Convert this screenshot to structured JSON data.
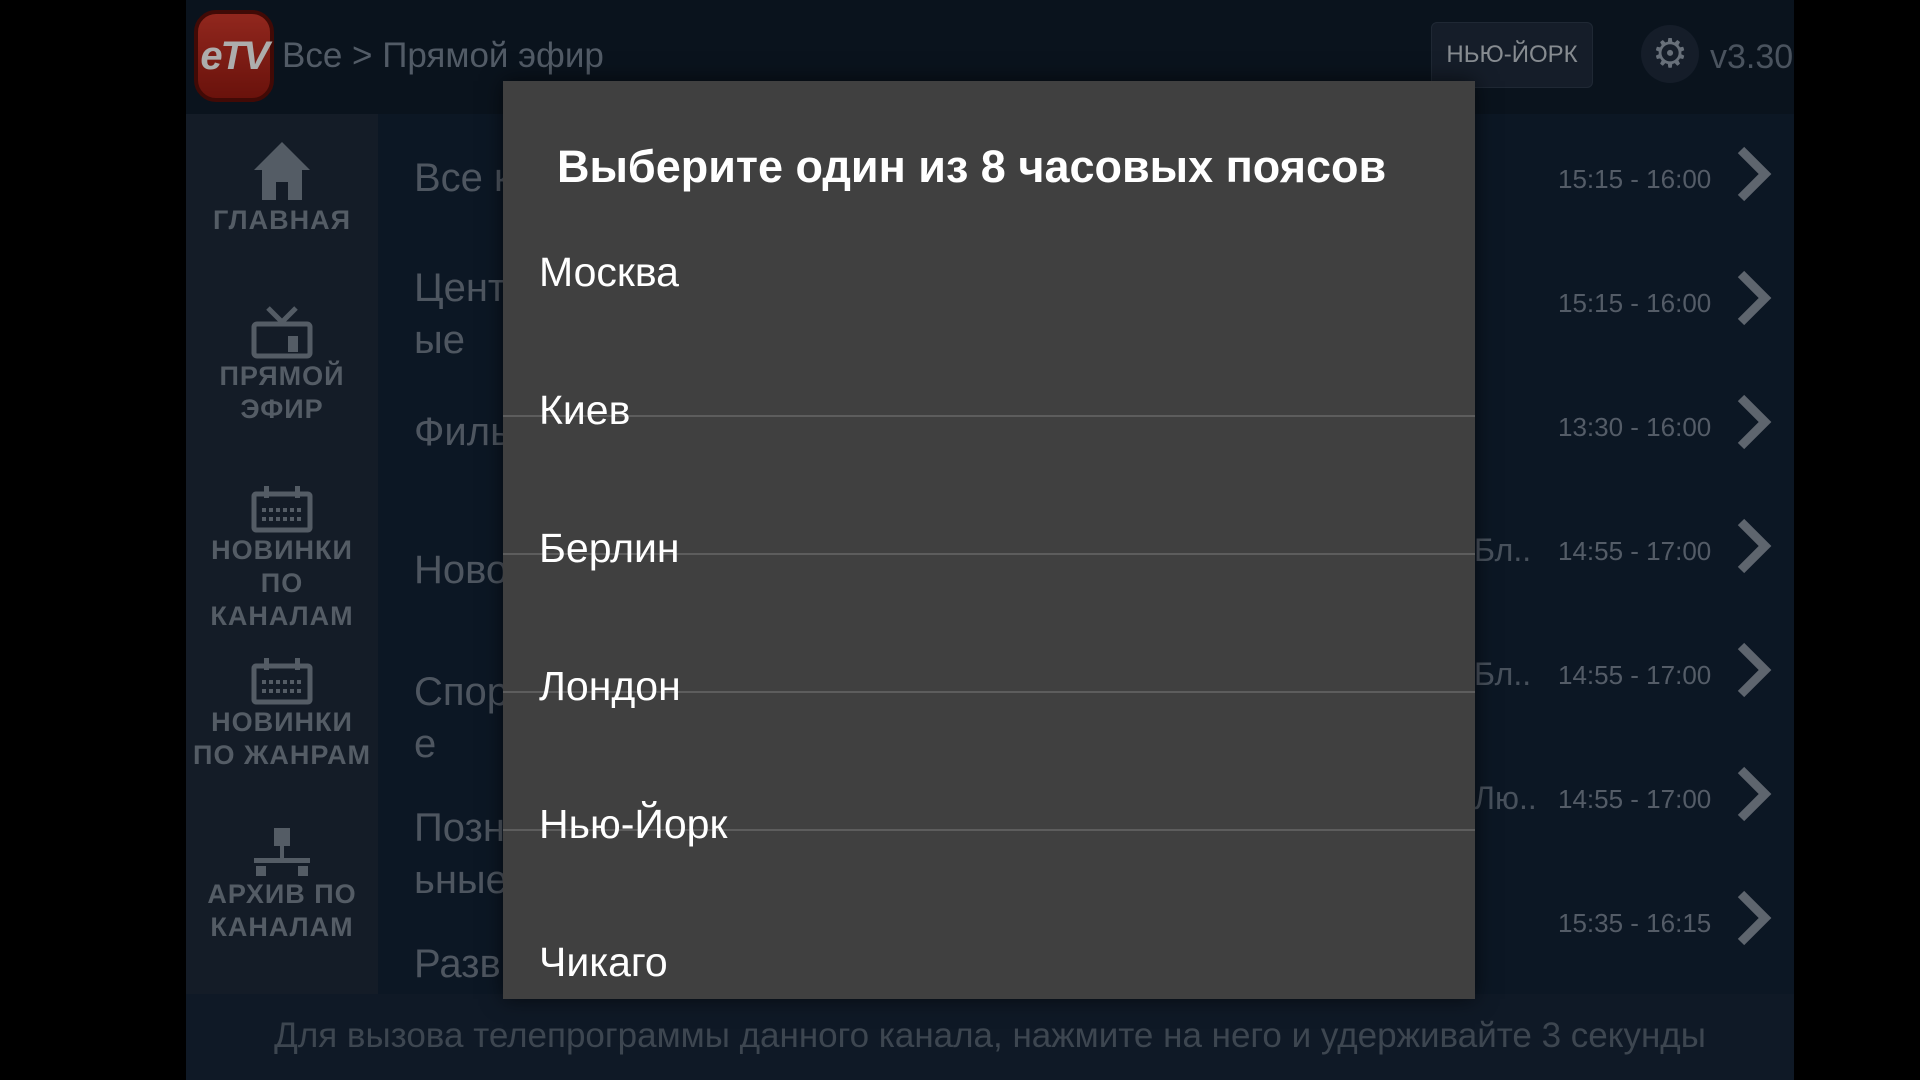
{
  "header": {
    "logo_text": "eTV",
    "breadcrumb": "Все > Прямой эфир",
    "city_button": "НЬЮ-ЙОРК",
    "version": "v3.30"
  },
  "sidebar": {
    "items": [
      {
        "label": "ГЛАВНАЯ",
        "icon": "home-icon"
      },
      {
        "label": "ПРЯМОЙ\nЭФИР",
        "icon": "tv-icon"
      },
      {
        "label": "НОВИНКИ\nПО КАНАЛАМ",
        "icon": "calendar-icon"
      },
      {
        "label": "НОВИНКИ\nПО ЖАНРАМ",
        "icon": "calendar-icon"
      },
      {
        "label": "АРХИВ ПО\nКАНАЛАМ",
        "icon": "network-icon"
      }
    ]
  },
  "rows": [
    {
      "title": "Все к",
      "show": "",
      "time": "15:15 - 16:00"
    },
    {
      "title": "Цент\nые",
      "show": "",
      "time": "15:15 - 16:00"
    },
    {
      "title": "Филь",
      "show": "",
      "time": "13:30 - 16:00"
    },
    {
      "title": "Ново",
      "show": "Бл..",
      "time": "14:55 - 17:00"
    },
    {
      "title": "Спор\nе",
      "show": "Бл..",
      "time": "14:55 - 17:00"
    },
    {
      "title": "Позн\nьные",
      "show": "Лю..",
      "time": "14:55 - 17:00"
    },
    {
      "title": "Разв",
      "show": "",
      "time": "15:35 - 16:15"
    }
  ],
  "footer": {
    "hint": "Для вызова телепрограммы данного канала, нажмите на него и удерживайте 3 секунды"
  },
  "dialog": {
    "title": "Выберите один из 8 часовых поясов",
    "options": [
      "Москва",
      "Киев",
      "Берлин",
      "Лондон",
      "Нью-Йорк",
      "Чикаго"
    ]
  }
}
